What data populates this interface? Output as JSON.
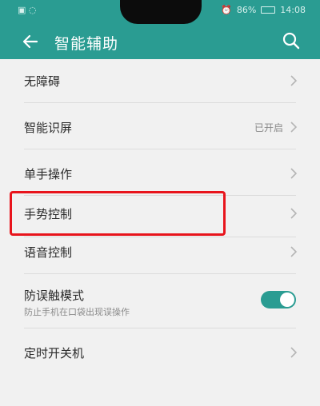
{
  "status_bar": {
    "left": "▣ ◌",
    "battery_percent": "86%",
    "time": "14:08"
  },
  "header": {
    "title": "智能辅助",
    "back_icon": "arrow-left-icon",
    "search_icon": "search-icon"
  },
  "settings": {
    "items": [
      {
        "label": "无障碍"
      },
      {
        "label": "智能识屏",
        "value": "已开启"
      },
      {
        "label": "单手操作"
      },
      {
        "label": "手势控制"
      },
      {
        "label": "语音控制"
      },
      {
        "label": "防误触模式",
        "description": "防止手机在口袋出现误操作",
        "toggle_on": true
      },
      {
        "label": "定时开关机"
      }
    ]
  },
  "colors": {
    "accent": "#2a9c92",
    "highlight_box": "#e8141c",
    "background": "#f1f1f1"
  }
}
